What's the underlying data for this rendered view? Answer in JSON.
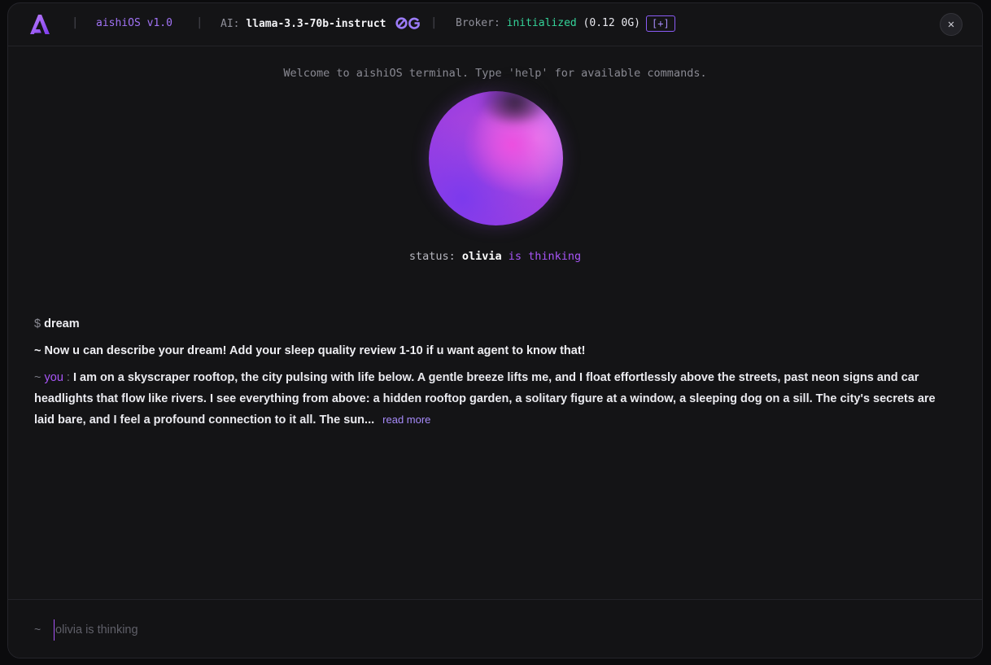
{
  "header": {
    "brand": "aishiOS v1.0",
    "ai_label": "AI:",
    "ai_model": "llama-3.3-70b-instruct",
    "broker_label": "Broker:",
    "broker_status": "initialized",
    "broker_balance": "(0.12 0G)",
    "plus_label": "[+]",
    "close_label": "✕",
    "separator": "|"
  },
  "welcome": "Welcome to aishiOS terminal. Type 'help' for available commands.",
  "status": {
    "label": "status:",
    "name": "olivia",
    "activity": "is thinking"
  },
  "log": {
    "command_prompt": "$",
    "command": "dream",
    "system_message": "~ Now u can describe your dream! Add your sleep quality review 1-10 if u want agent to know that!",
    "user_prefix": "~",
    "user_name": "you",
    "user_colon": ":",
    "user_message": "I am on a skyscraper rooftop, the city pulsing with life below. A gentle breeze lifts me, and I float effortlessly above the streets, past neon signs and car headlights that flow like rivers. I see everything from above: a hidden rooftop garden, a solitary figure at a window, a sleeping dog on a sill. The city's secrets are laid bare, and I feel a profound connection to it all. The sun...",
    "read_more": "read more"
  },
  "input": {
    "prompt": "~",
    "placeholder": "olivia is thinking",
    "value": ""
  },
  "colors": {
    "accent": "#a855f7",
    "green": "#34d399",
    "background": "#141416"
  }
}
